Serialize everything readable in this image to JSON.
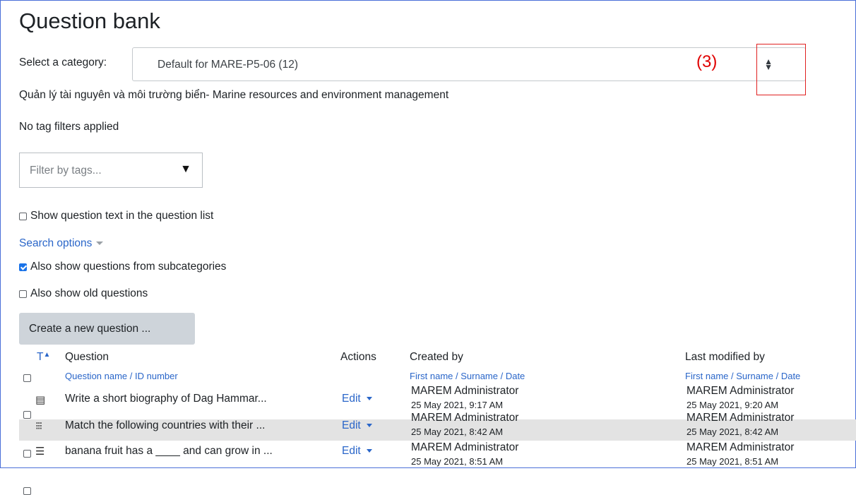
{
  "page": {
    "title": "Question bank"
  },
  "category": {
    "label": "Select a category:",
    "value": "Default for MARE-P5-06 (12)",
    "arrows_icon": "sort-arrows-icon"
  },
  "annotation": {
    "label": "(3)",
    "color": "#e00000"
  },
  "course_description": "Quản lý tài nguyên và môi trường biển- Marine resources and environment management",
  "tags": {
    "status": "No tag filters applied",
    "filter_placeholder": "Filter by tags...",
    "arrow": "▼"
  },
  "options": {
    "show_text": {
      "label": "Show question text in the question list",
      "checked": false
    },
    "search_options_label": "Search options",
    "subcategories": {
      "label": "Also show questions from subcategories",
      "checked": true
    },
    "old_questions": {
      "label": "Also show old questions",
      "checked": false
    }
  },
  "create_button": "Create a new question ...",
  "table": {
    "type_header": "T",
    "question_header": "Question",
    "question_sub": "Question name / ID number",
    "actions_header": "Actions",
    "created_header": "Created by",
    "created_sub": "First name / Surname / Date",
    "modified_header": "Last modified by",
    "modified_sub": "First name / Surname / Date",
    "rows": [
      {
        "icon": "▤",
        "name": "Write a short biography of Dag Hammar...",
        "action": "Edit",
        "created_by": "MAREM Administrator",
        "created_date": "25 May 2021, 9:17 AM",
        "modified_by": "MAREM Administrator",
        "modified_date": "25 May 2021, 9:20 AM"
      },
      {
        "icon": "⁝⁝⁝",
        "name": "Match the following countries with their ...",
        "action": "Edit",
        "created_by": "MAREM Administrator",
        "created_date": "25 May 2021, 8:42 AM",
        "modified_by": "MAREM Administrator",
        "modified_date": "25 May 2021, 8:42 AM"
      },
      {
        "icon": "☰",
        "name": "banana fruit has a ____ and can grow in ...",
        "action": "Edit",
        "created_by": "MAREM Administrator",
        "created_date": "25 May 2021, 8:51 AM",
        "modified_by": "MAREM Administrator",
        "modified_date": "25 May 2021, 8:51 AM"
      }
    ]
  }
}
